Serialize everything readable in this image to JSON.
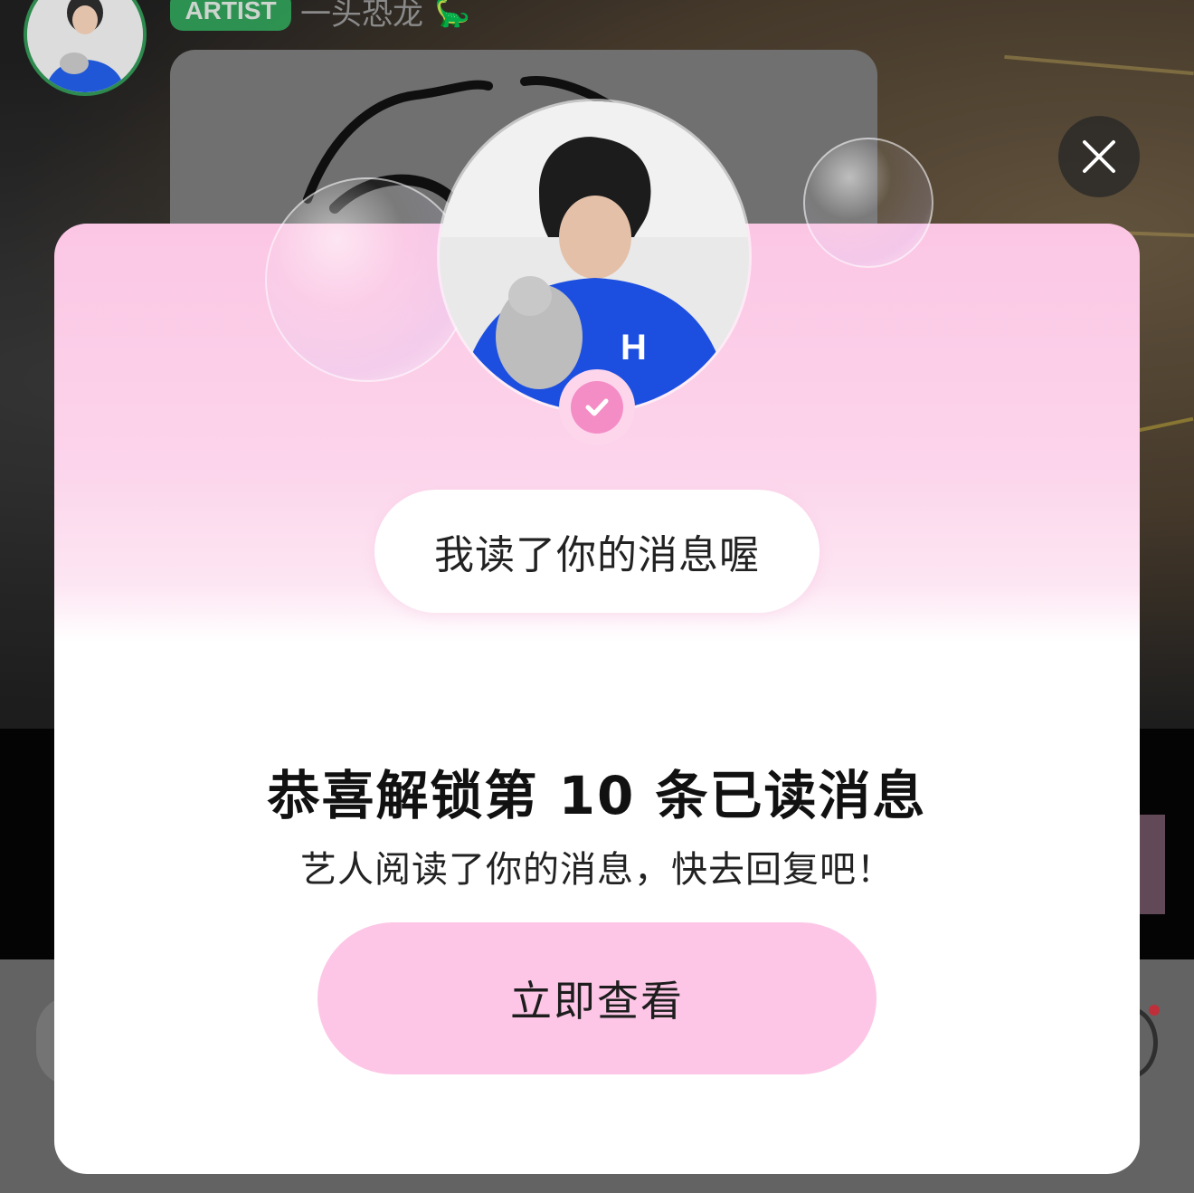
{
  "header": {
    "badge_label": "ARTIST",
    "artist_name": "一头恐龙",
    "artist_emoji": "🦕"
  },
  "modal": {
    "message_bubble": "我读了你的消息喔",
    "title": "恭喜解锁第 10 条已读消息",
    "subtitle": "艺人阅读了你的消息，快去回复吧！",
    "cta_label": "立即查看"
  },
  "colors": {
    "accent_pink": "#fdc6e6",
    "verified_pink": "#f48cc5",
    "badge_green": "#2fa65a"
  },
  "icons": {
    "close": "close-icon",
    "verified": "check-badge-icon"
  }
}
